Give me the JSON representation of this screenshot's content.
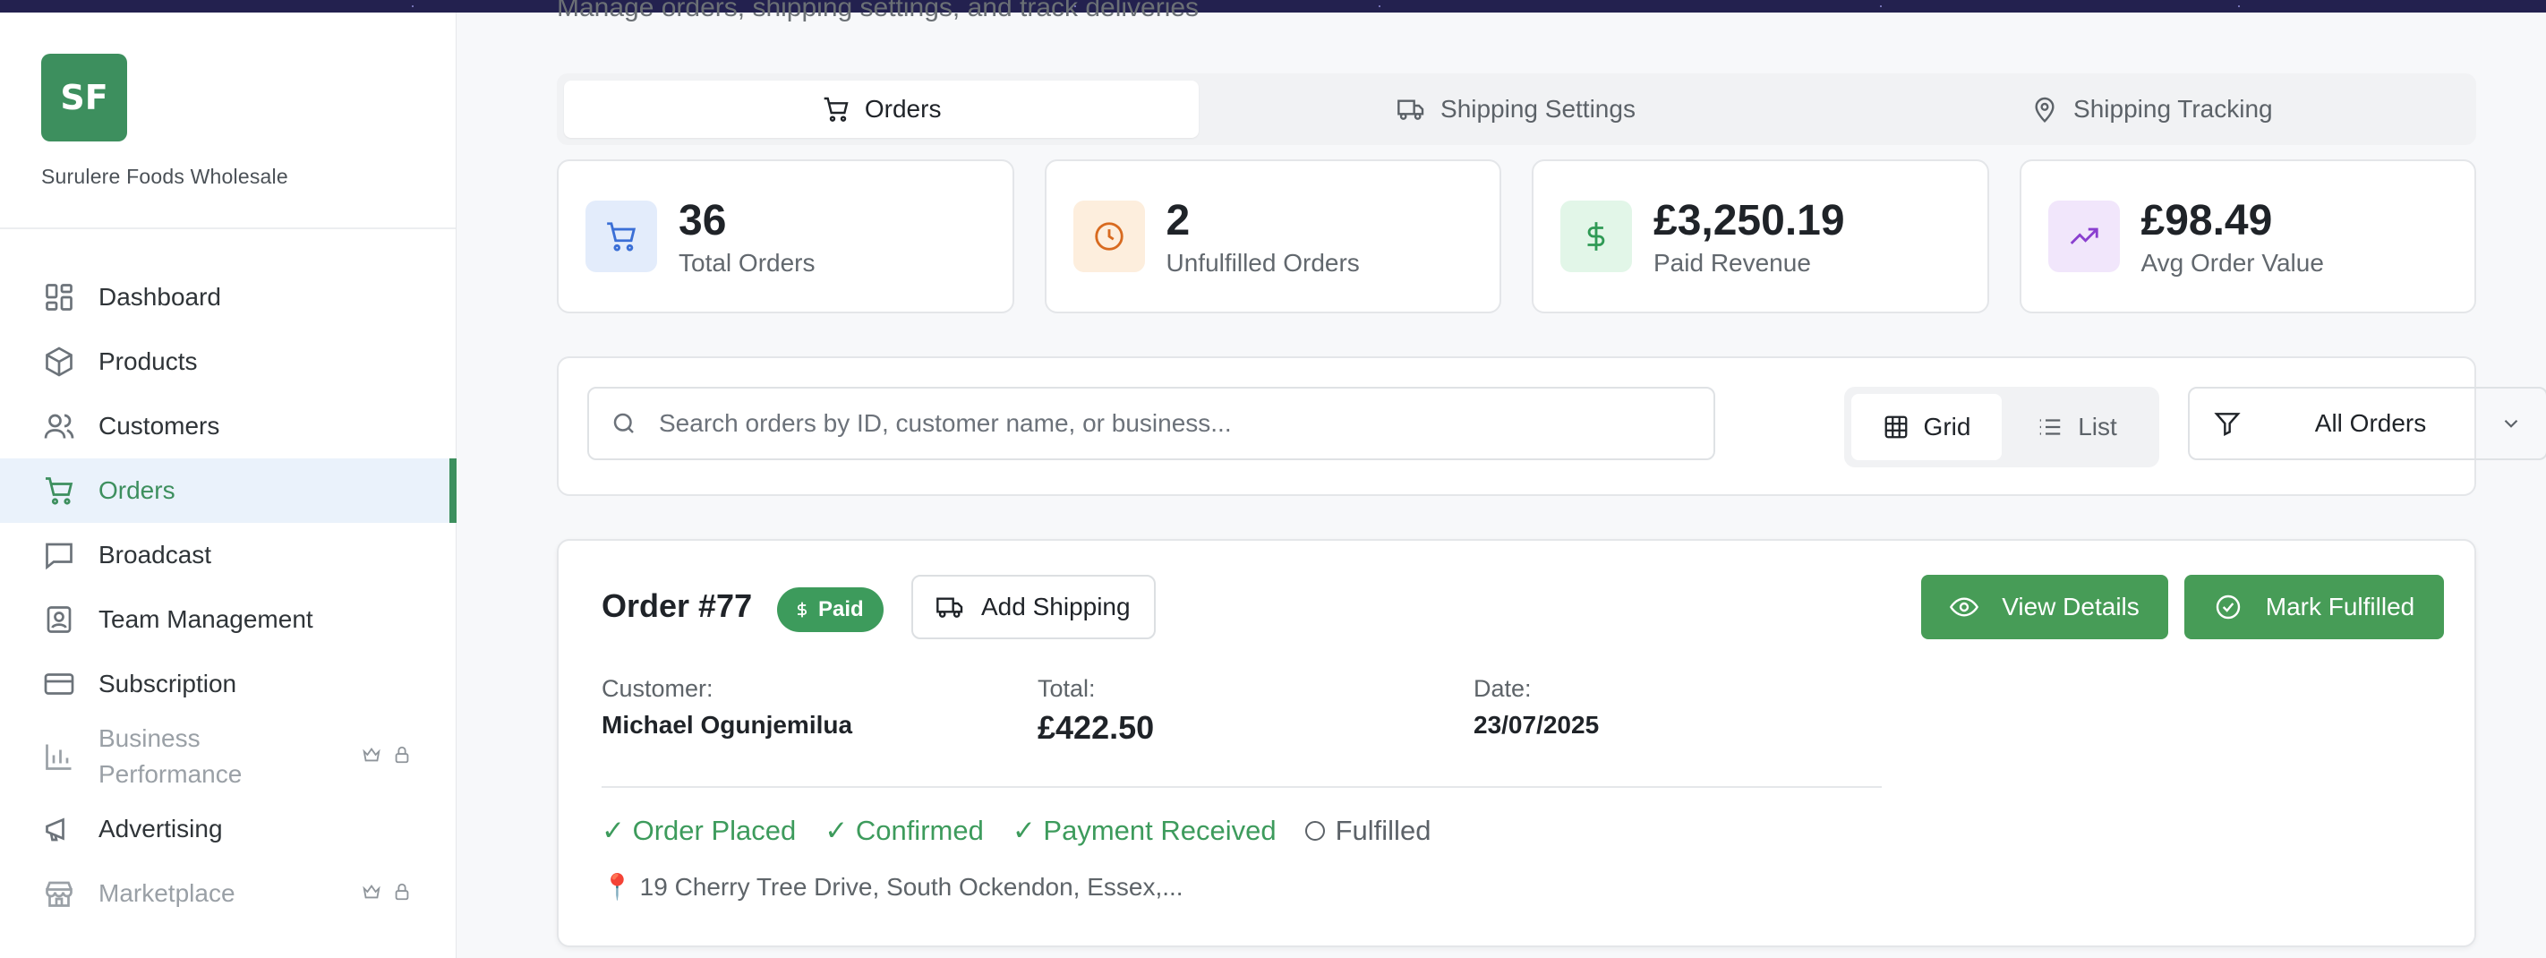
{
  "brand": {
    "initials": "SF",
    "name": "Surulere Foods Wholesale"
  },
  "nav": {
    "items": [
      {
        "label": "Dashboard",
        "icon": "dashboard-icon"
      },
      {
        "label": "Products",
        "icon": "package-icon"
      },
      {
        "label": "Customers",
        "icon": "users-icon"
      },
      {
        "label": "Orders",
        "icon": "cart-icon",
        "active": true
      },
      {
        "label": "Broadcast",
        "icon": "message-icon"
      },
      {
        "label": "Team Management",
        "icon": "badge-icon"
      },
      {
        "label": "Subscription",
        "icon": "card-icon"
      },
      {
        "label": "Business Performance",
        "icon": "bar-chart-icon",
        "locked": true
      },
      {
        "label": "Advertising",
        "icon": "megaphone-icon"
      },
      {
        "label": "Marketplace",
        "icon": "store-icon",
        "locked": true
      }
    ]
  },
  "header": {
    "subtitle": "Manage orders, shipping settings, and track deliveries"
  },
  "tabs": [
    {
      "label": "Orders",
      "icon": "cart-icon",
      "active": true
    },
    {
      "label": "Shipping Settings",
      "icon": "truck-icon"
    },
    {
      "label": "Shipping Tracking",
      "icon": "map-pin-icon"
    }
  ],
  "stats": [
    {
      "value": "36",
      "label": "Total Orders",
      "icon": "cart-icon",
      "color": "#3b6fd6",
      "bg": "#e3ecfb"
    },
    {
      "value": "2",
      "label": "Unfulfilled Orders",
      "icon": "clock-icon",
      "color": "#d86a1f",
      "bg": "#fdeedd"
    },
    {
      "value": "£3,250.19",
      "label": "Paid Revenue",
      "icon": "dollar-icon",
      "color": "#2f9a55",
      "bg": "#e2f6e8"
    },
    {
      "value": "£98.49",
      "label": "Avg Order Value",
      "icon": "trending-up-icon",
      "color": "#8a3fcf",
      "bg": "#f1e6fb"
    }
  ],
  "toolbar": {
    "search_placeholder": "Search orders by ID, customer name, or business...",
    "view_grid": "Grid",
    "view_list": "List",
    "filter_value": "All Orders"
  },
  "order": {
    "title": "Order #77",
    "status": "Paid",
    "add_shipping": "Add Shipping",
    "view_details": "View Details",
    "mark_fulfilled": "Mark Fulfilled",
    "customer_label": "Customer:",
    "customer": "Michael Ogunjemilua",
    "total_label": "Total:",
    "total": "£422.50",
    "date_label": "Date:",
    "date": "23/07/2025",
    "steps": [
      "✓ Order Placed",
      "✓ Confirmed",
      "✓ Payment Received"
    ],
    "pending_step": "Fulfilled",
    "address": "📍 19 Cherry Tree Drive, South Ockendon, Essex,..."
  },
  "colors": {
    "accent": "#3d8f5e",
    "primary_button": "#479c57"
  }
}
